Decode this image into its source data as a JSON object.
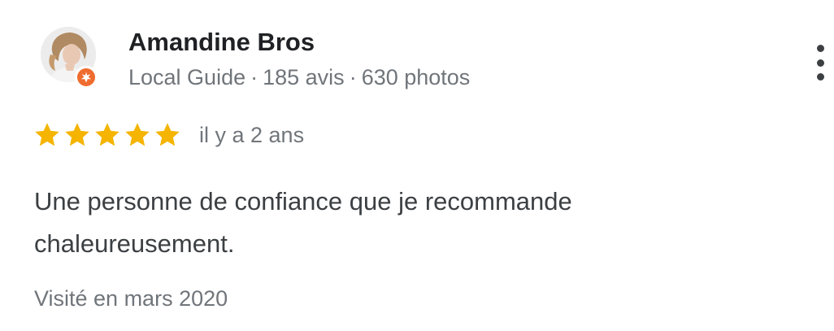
{
  "review": {
    "author": {
      "name": "Amandine Bros",
      "level": "Local Guide",
      "separator": "·",
      "reviews_count": "185 avis",
      "photos_count": "630 photos",
      "avatar_icon": "profile-photo",
      "badge_icon": "local-guide-star-badge",
      "badge_color": "#ef6c2f"
    },
    "rating": {
      "stars": 5,
      "max_stars": 5,
      "star_color": "#f5b400"
    },
    "time_ago": "il y a 2 ans",
    "text": "Une personne de confiance que je recommande chaleureusement.",
    "visit": "Visité en mars 2020",
    "more_icon": "more-vertical-icon"
  }
}
